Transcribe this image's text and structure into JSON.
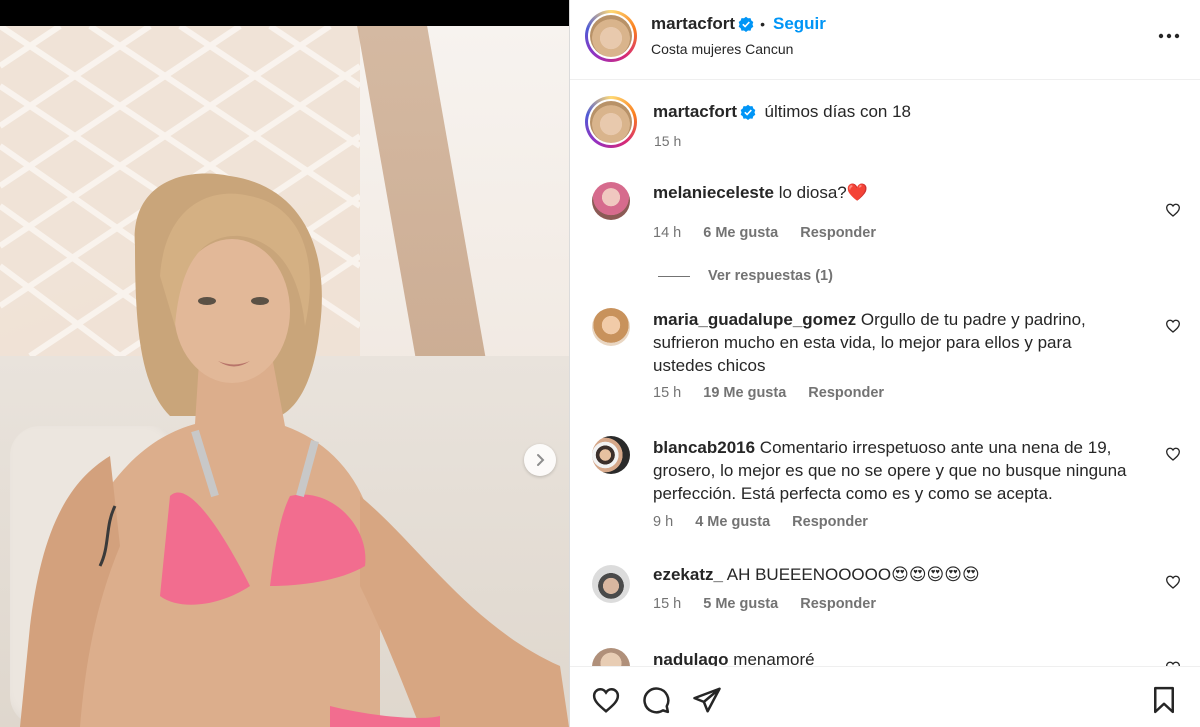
{
  "post": {
    "author": {
      "username": "martacfort",
      "verified": true,
      "location": "Costa mujeres Cancun",
      "follow_label": "Seguir"
    },
    "caption": {
      "username": "martacfort",
      "text": "últimos días con 18",
      "time": "15 h"
    }
  },
  "comments": [
    {
      "username": "melanieceleste",
      "text": "lo diosa?",
      "emoji": "❤️",
      "time": "14 h",
      "likes": "6 Me gusta",
      "reply_label": "Responder",
      "view_replies": "Ver respuestas (1)"
    },
    {
      "username": "maria_guadalupe_gomez",
      "text": "Orgullo de tu padre y padrino, sufrieron mucho en esta vida, lo mejor para ellos y para ustedes chicos",
      "time": "15 h",
      "likes": "19 Me gusta",
      "reply_label": "Responder"
    },
    {
      "username": "blancab2016",
      "text": "Comentario irrespetuoso ante una nena de 19, grosero, lo mejor es que no se opere y que no busque ninguna perfección. Está perfecta como es y como se acepta.",
      "time": "9 h",
      "likes": "4 Me gusta",
      "reply_label": "Responder"
    },
    {
      "username": "ezekatz_",
      "text": "AH BUEEENOOOOO",
      "emoji": "😍😍😍😍😍",
      "time": "15 h",
      "likes": "5 Me gusta",
      "reply_label": "Responder"
    },
    {
      "username": "nadulago",
      "text": "menamoré"
    }
  ],
  "icons": {
    "like": "heart-icon",
    "comment": "comment-icon",
    "share": "share-icon",
    "save": "bookmark-icon",
    "more": "more-options-icon",
    "next": "chevron-right-icon"
  },
  "colors": {
    "link_blue": "#0095f6",
    "verified_blue": "#0095f6",
    "meta_gray": "#737373",
    "text": "#262626"
  }
}
